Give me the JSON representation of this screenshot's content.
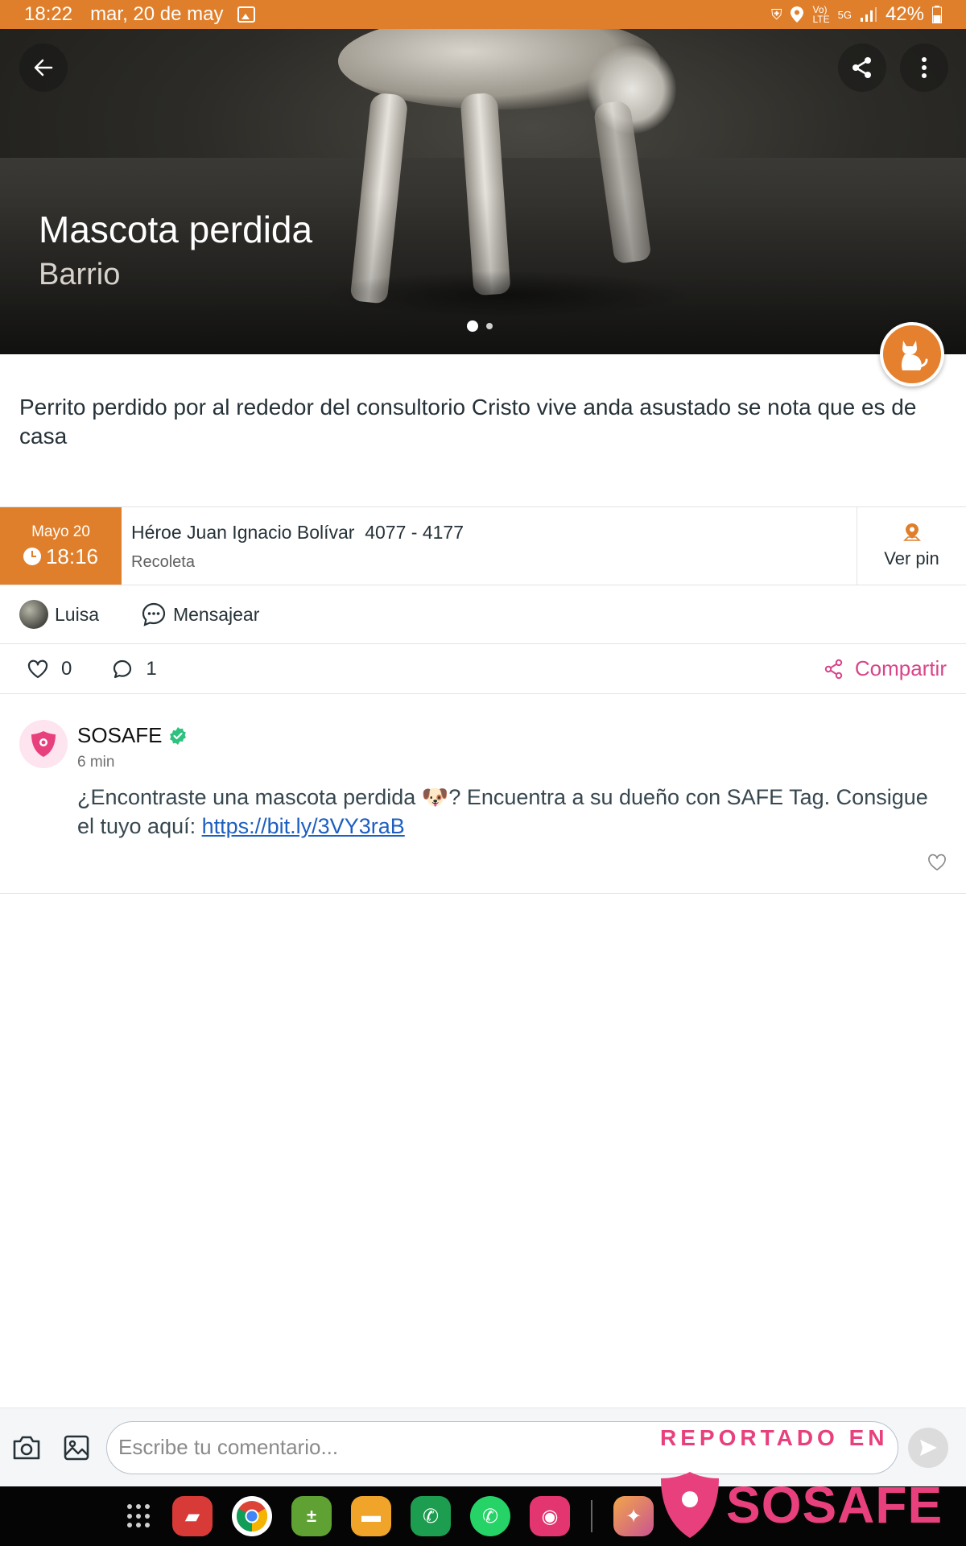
{
  "status_bar": {
    "time": "18:22",
    "date": "mar, 20 de may",
    "battery": "42%",
    "icons": [
      "gallery-icon",
      "shield-icon",
      "location-icon",
      "volte-icon",
      "5g-icon",
      "signal-icon",
      "battery-icon"
    ]
  },
  "hero": {
    "title": "Mascota perdida",
    "subtitle": "Barrio",
    "slides_total": 2,
    "active_slide": 1,
    "badge_icon": "cat-icon"
  },
  "description": "Perrito perdido por al rededor del consultorio Cristo vive anda asustado se nota que es de casa",
  "info": {
    "month_day": "Mayo 20",
    "time": "18:16",
    "street": "Héroe Juan Ignacio Bolívar  4077 - 4177",
    "district": "Recoleta",
    "pin_label": "Ver pin"
  },
  "author": {
    "name": "Luisa",
    "message_label": "Mensajear"
  },
  "reactions": {
    "likes": "0",
    "comments": "1",
    "share_label": "Compartir"
  },
  "comment": {
    "author": "SOSAFE",
    "time": "6 min",
    "text_before": "¿Encontraste una mascota perdida 🐶? Encuentra a su dueño con SAFE Tag. Consigue el tuyo aquí: ",
    "link": "https://bit.ly/3VY3raB"
  },
  "comment_bar": {
    "placeholder": "Escribe tu comentario..."
  },
  "watermark": {
    "line1": "REPORTADO EN",
    "brand": "SOSAFE"
  },
  "colors": {
    "accent_orange": "#e07f2b",
    "brand_pink": "#e8407c",
    "share_pink": "#d8458a"
  }
}
